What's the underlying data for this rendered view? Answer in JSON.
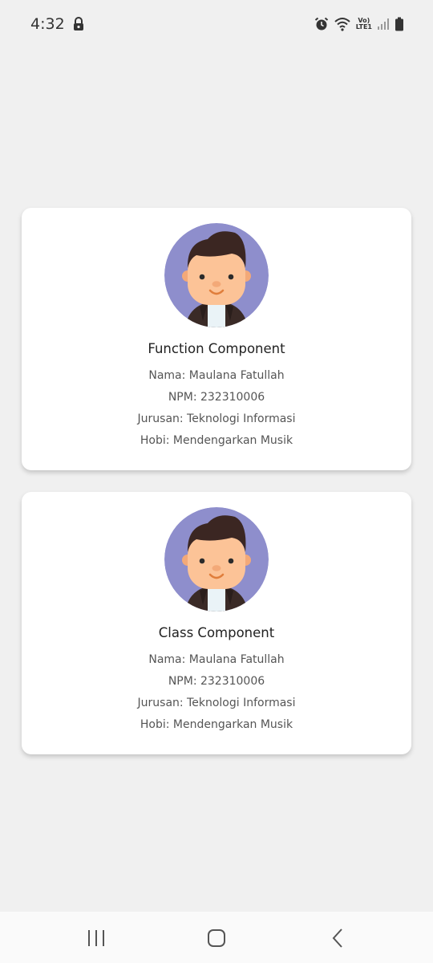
{
  "status_bar": {
    "time": "4:32",
    "network_label_top": "Vo)",
    "network_label_bottom": "LTE1"
  },
  "cards": [
    {
      "title": "Function Component",
      "nama": "Nama: Maulana Fatullah",
      "npm": "NPM: 232310006",
      "jurusan": "Jurusan: Teknologi Informasi",
      "hobi": "Hobi: Mendengarkan Musik"
    },
    {
      "title": "Class Component",
      "nama": "Nama: Maulana Fatullah",
      "npm": "NPM: 232310006",
      "jurusan": "Jurusan: Teknologi Informasi",
      "hobi": "Hobi: Mendengarkan Musik"
    }
  ],
  "icons": {
    "lock": "lock-icon",
    "alarm": "alarm-icon",
    "wifi": "wifi-icon",
    "signal": "signal-icon",
    "battery": "battery-icon",
    "recent": "recent-apps-icon",
    "home": "home-icon",
    "back": "back-icon"
  },
  "colors": {
    "background": "#f0f0f0",
    "card": "#ffffff",
    "avatar_bg": "#8e8ecc"
  }
}
